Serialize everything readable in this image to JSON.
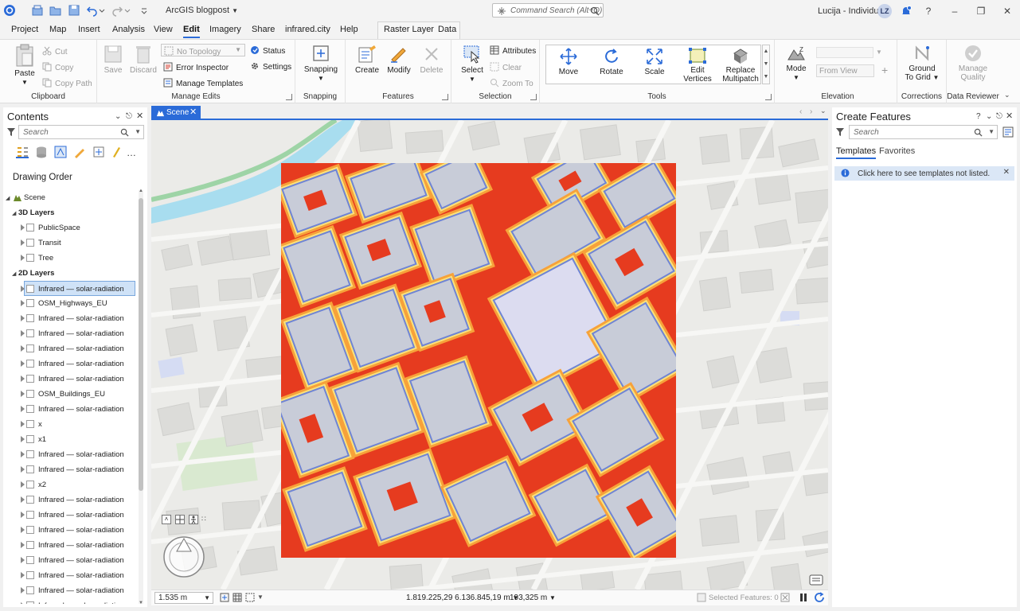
{
  "titlebar": {
    "app_title": "ArcGIS blogpost",
    "command_search_placeholder": "Command Search (Alt+Q)",
    "user_name": "Lucija - Individual",
    "user_initials": "LZ"
  },
  "menu": {
    "tabs": [
      "Project",
      "Map",
      "Insert",
      "Analysis",
      "View",
      "Edit",
      "Imagery",
      "Share",
      "infrared.city",
      "Help"
    ],
    "active": "Edit",
    "context_tabs": [
      "Raster Layer",
      "Data"
    ]
  },
  "ribbon": {
    "clipboard": {
      "label": "Clipboard",
      "paste": "Paste",
      "cut": "Cut",
      "copy": "Copy",
      "copy_path": "Copy Path"
    },
    "manage_edits": {
      "label": "Manage Edits",
      "save": "Save",
      "discard": "Discard",
      "topology": "No Topology",
      "status": "Status",
      "error_inspector": "Error Inspector",
      "settings": "Settings",
      "manage_templates": "Manage Templates"
    },
    "snapping": {
      "label": "Snapping",
      "button": "Snapping"
    },
    "features": {
      "label": "Features",
      "create": "Create",
      "modify": "Modify",
      "delete": "Delete"
    },
    "selection": {
      "label": "Selection",
      "select": "Select",
      "attributes": "Attributes",
      "clear": "Clear",
      "zoom_to": "Zoom To"
    },
    "tools": {
      "label": "Tools",
      "move": "Move",
      "rotate": "Rotate",
      "scale": "Scale",
      "edit_vertices_1": "Edit",
      "edit_vertices_2": "Vertices",
      "replace_multipatch_1": "Replace",
      "replace_multipatch_2": "Multipatch"
    },
    "elevation": {
      "label": "Elevation",
      "mode": "Mode",
      "from_view": "From View"
    },
    "corrections": {
      "label": "Corrections",
      "ground_1": "Ground",
      "ground_2": "To Grid"
    },
    "data_reviewer": {
      "label": "Data Reviewer",
      "manage_1": "Manage",
      "manage_2": "Quality"
    }
  },
  "contents": {
    "title": "Contents",
    "search_placeholder": "Search",
    "drawing_order": "Drawing Order",
    "scene": "Scene",
    "layers_3d_title": "3D Layers",
    "layers_3d": [
      "PublicSpace",
      "Transit",
      "Tree"
    ],
    "layers_2d_title": "2D Layers",
    "layers_2d": [
      "Infrared — solar-radiation",
      "OSM_Highways_EU",
      "Infrared — solar-radiation",
      "Infrared — solar-radiation",
      "Infrared — solar-radiation",
      "Infrared — solar-radiation",
      "Infrared — solar-radiation",
      "OSM_Buildings_EU",
      "Infrared — solar-radiation",
      "x",
      "x1",
      "Infrared — solar-radiation",
      "Infrared — solar-radiation",
      "x2",
      "Infrared — solar-radiation",
      "Infrared — solar-radiation",
      "Infrared — solar-radiation",
      "Infrared — solar-radiation",
      "Infrared — solar-radiation",
      "Infrared — solar-radiation",
      "Infrared — solar-radiation",
      "Infrared — solar-radiation",
      "Infrared — solar-radiation"
    ],
    "selected_index": 0
  },
  "view": {
    "tab": "Scene",
    "scale": "1.535 m",
    "coordinates": "1.819.225,29 6.136.845,19 m",
    "elevation": "193,325 m",
    "selected_features": "Selected Features: 0"
  },
  "create_features": {
    "title": "Create Features",
    "search_placeholder": "Search",
    "tabs": [
      "Templates",
      "Favorites"
    ],
    "info": "Click here to see templates not listed."
  },
  "colors": {
    "accent": "#2b6bd8",
    "raster_high": "#e63b1f",
    "raster_mid": "#f7a23a",
    "raster_warm": "#fbe27a",
    "raster_cool": "#6f84d4",
    "raster_low": "#c8ccd8"
  }
}
